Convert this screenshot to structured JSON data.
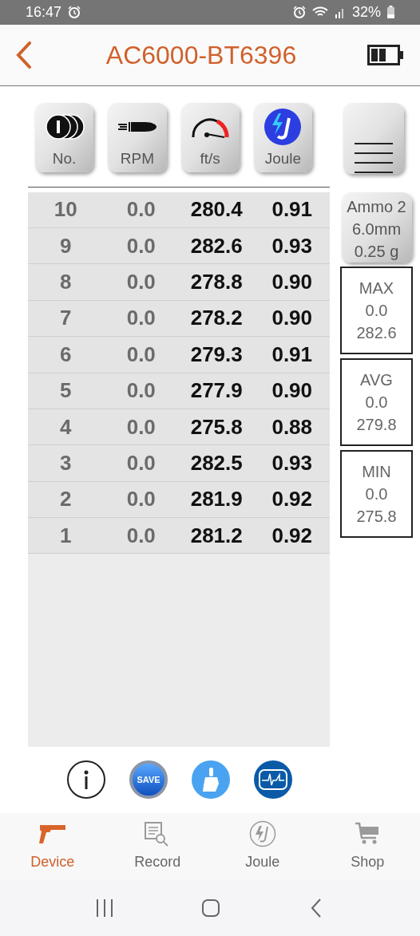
{
  "status_bar": {
    "time": "16:47",
    "battery": "32%"
  },
  "header": {
    "title": "AC6000-BT6396"
  },
  "columns": [
    {
      "kind": "count",
      "label": "No."
    },
    {
      "kind": "bullet",
      "label": "RPM"
    },
    {
      "kind": "gauge",
      "label": "ft/s"
    },
    {
      "kind": "joule",
      "label": "Joule"
    }
  ],
  "rows": [
    [
      "10",
      "0.0",
      "280.4",
      "0.91"
    ],
    [
      "9",
      "0.0",
      "282.6",
      "0.93"
    ],
    [
      "8",
      "0.0",
      "278.8",
      "0.90"
    ],
    [
      "7",
      "0.0",
      "278.2",
      "0.90"
    ],
    [
      "6",
      "0.0",
      "279.3",
      "0.91"
    ],
    [
      "5",
      "0.0",
      "277.9",
      "0.90"
    ],
    [
      "4",
      "0.0",
      "275.8",
      "0.88"
    ],
    [
      "3",
      "0.0",
      "282.5",
      "0.93"
    ],
    [
      "2",
      "0.0",
      "281.9",
      "0.92"
    ],
    [
      "1",
      "0.0",
      "281.2",
      "0.92"
    ]
  ],
  "ammo": {
    "name": "Ammo 2",
    "caliber": "6.0mm",
    "weight": "0.25 g"
  },
  "stats": [
    {
      "label": "MAX",
      "rpm": "0.0",
      "speed": "282.6"
    },
    {
      "label": "AVG",
      "rpm": "0.0",
      "speed": "279.8"
    },
    {
      "label": "MIN",
      "rpm": "0.0",
      "speed": "275.8"
    }
  ],
  "actions": [
    {
      "kind": "info"
    },
    {
      "kind": "save",
      "label": "SAVE"
    },
    {
      "kind": "clear"
    },
    {
      "kind": "scope"
    }
  ],
  "nav": [
    {
      "kind": "device",
      "label": "Device",
      "selected": true
    },
    {
      "kind": "record",
      "label": "Record",
      "selected": false
    },
    {
      "kind": "joule",
      "label": "Joule",
      "selected": false
    },
    {
      "kind": "shop",
      "label": "Shop",
      "selected": false
    }
  ]
}
